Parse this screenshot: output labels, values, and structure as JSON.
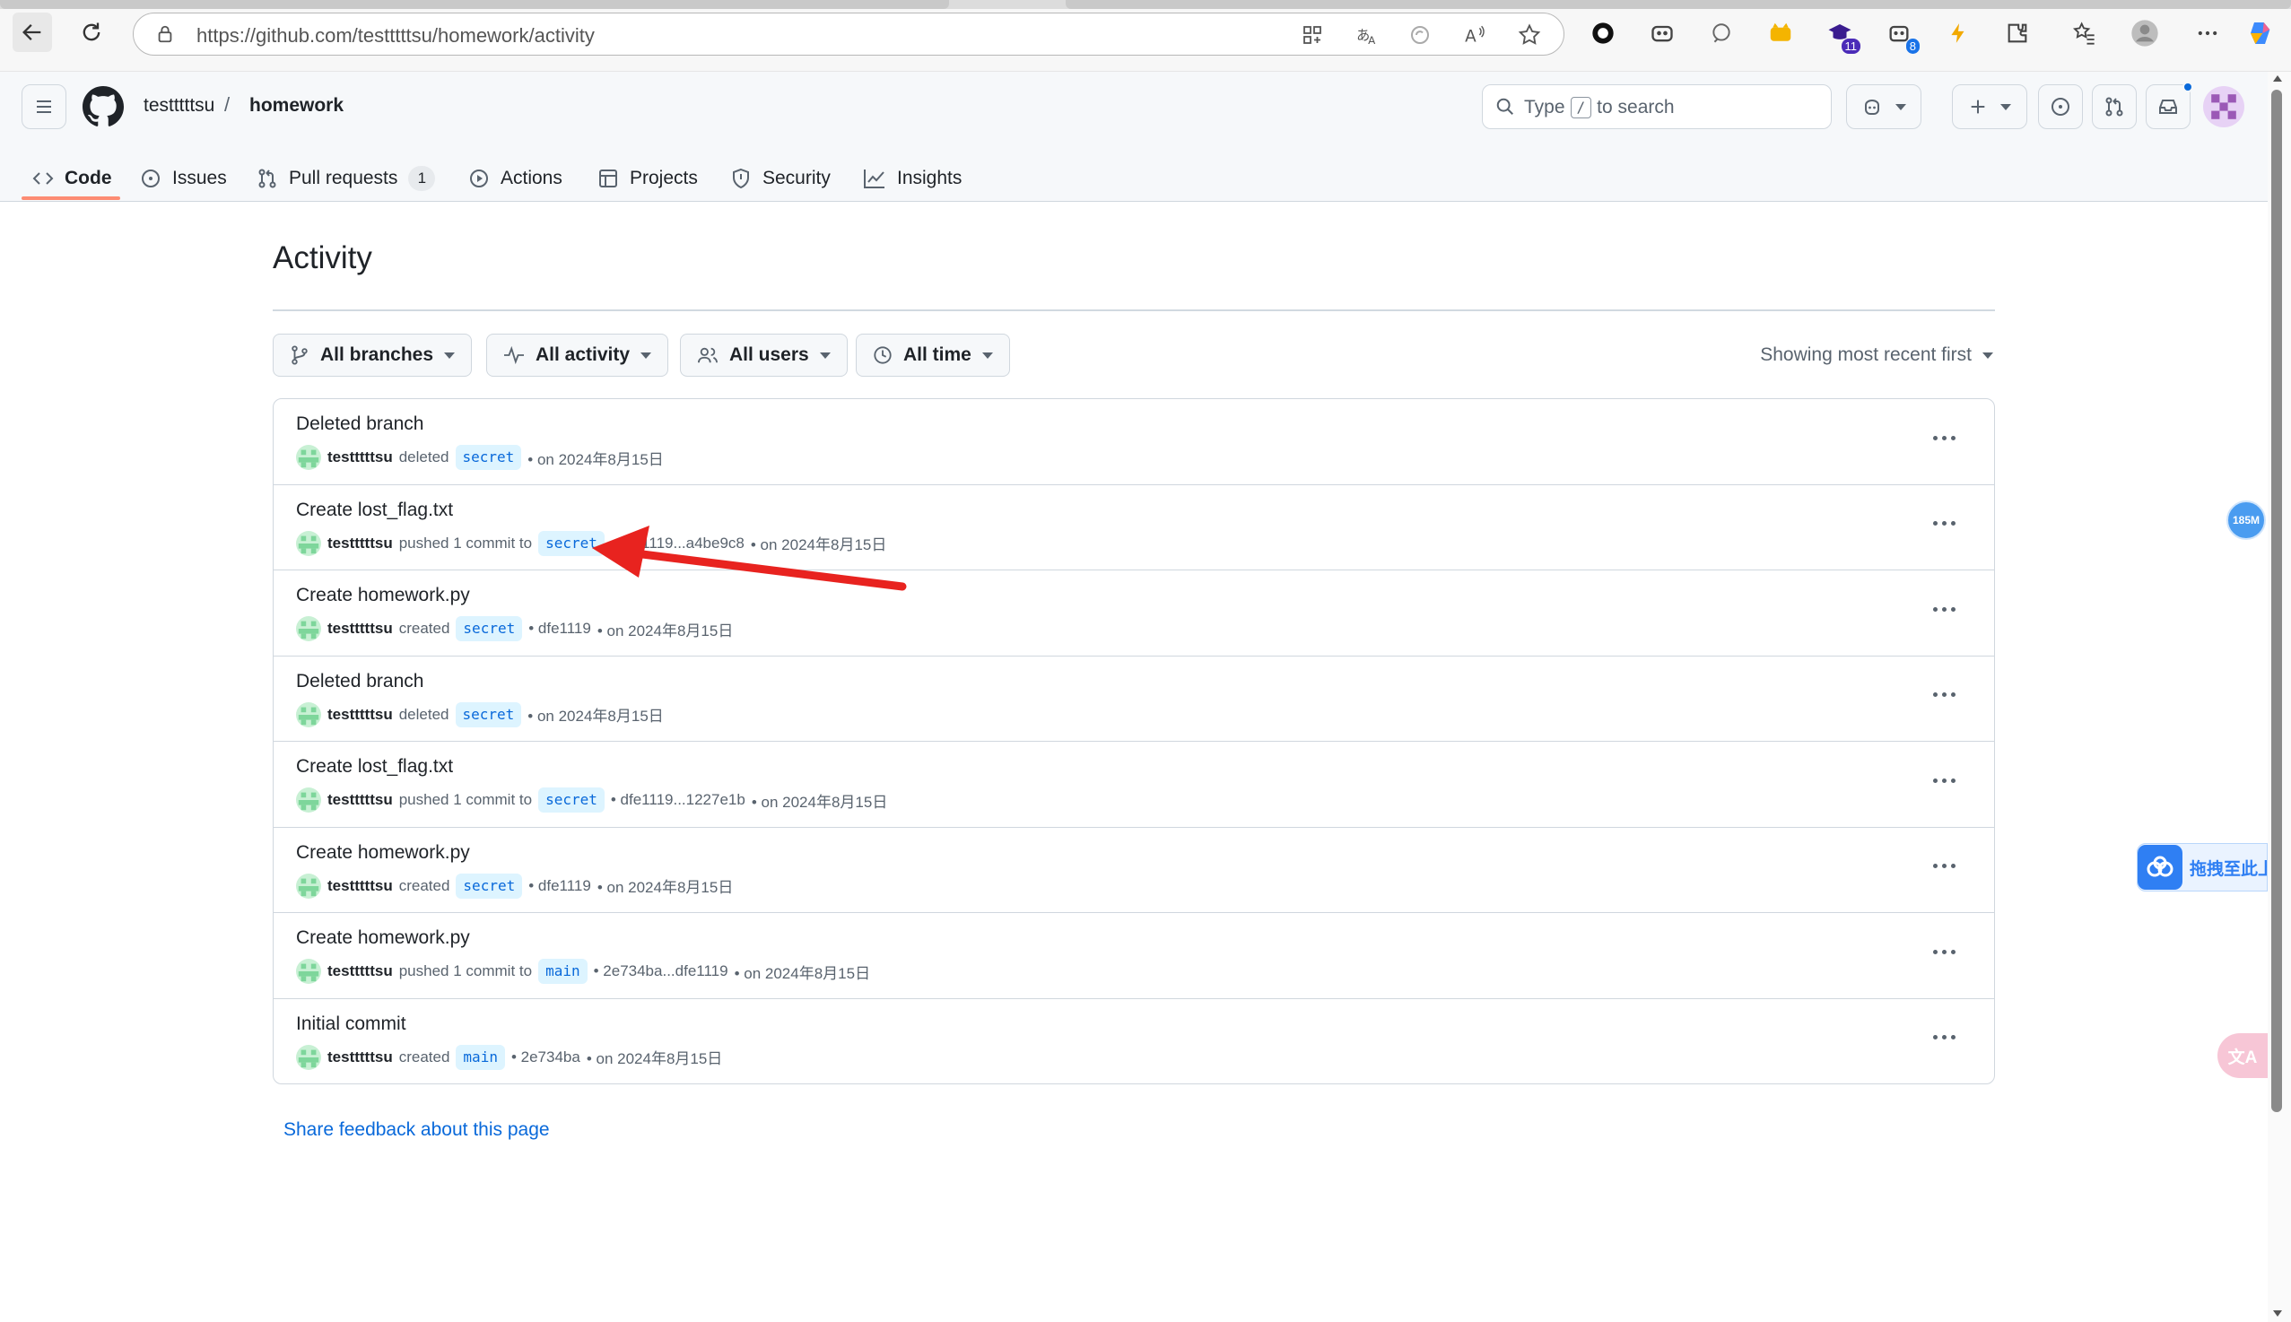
{
  "browser": {
    "url": "https://github.com/testttttsu/homework/activity",
    "extension_badges": {
      "ext_6": "11",
      "ext_7": "8"
    }
  },
  "header": {
    "owner": "testttttsu",
    "separator": "/",
    "repo": "homework",
    "search": {
      "pre": "Type",
      "key": "/",
      "post": "to search"
    }
  },
  "tabs": [
    {
      "label": "Code",
      "icon": "code-icon",
      "selected": true
    },
    {
      "label": "Issues",
      "icon": "issue-icon"
    },
    {
      "label": "Pull requests",
      "icon": "pull-request-icon",
      "count": "1"
    },
    {
      "label": "Actions",
      "icon": "play-icon"
    },
    {
      "label": "Projects",
      "icon": "table-icon"
    },
    {
      "label": "Security",
      "icon": "shield-icon"
    },
    {
      "label": "Insights",
      "icon": "graph-icon"
    }
  ],
  "page": {
    "title": "Activity",
    "filters": {
      "branches": "All branches",
      "activity": "All activity",
      "users": "All users",
      "time": "All time"
    },
    "sort": "Showing most recent first",
    "feedback": "Share feedback about this page"
  },
  "activities": [
    {
      "title": "Deleted branch",
      "user": "testttttsu",
      "verb": "deleted",
      "branch": "secret",
      "sha": "",
      "date": "• on 2024年8月15日"
    },
    {
      "title": "Create lost_flag.txt",
      "user": "testttttsu",
      "verb": "pushed 1 commit to",
      "branch": "secret",
      "sha": "• dfe1119...a4be9c8",
      "date": "• on 2024年8月15日"
    },
    {
      "title": "Create homework.py",
      "user": "testttttsu",
      "verb": "created",
      "branch": "secret",
      "sha": "• dfe1119",
      "date": "• on 2024年8月15日"
    },
    {
      "title": "Deleted branch",
      "user": "testttttsu",
      "verb": "deleted",
      "branch": "secret",
      "sha": "",
      "date": "• on 2024年8月15日"
    },
    {
      "title": "Create lost_flag.txt",
      "user": "testttttsu",
      "verb": "pushed 1 commit to",
      "branch": "secret",
      "sha": "• dfe1119...1227e1b",
      "date": "• on 2024年8月15日"
    },
    {
      "title": "Create homework.py",
      "user": "testttttsu",
      "verb": "created",
      "branch": "secret",
      "sha": "• dfe1119",
      "date": "• on 2024年8月15日"
    },
    {
      "title": "Create homework.py",
      "user": "testttttsu",
      "verb": "pushed 1 commit to",
      "branch": "main",
      "sha": "• 2e734ba...dfe1119",
      "date": "• on 2024年8月15日"
    },
    {
      "title": "Initial commit",
      "user": "testttttsu",
      "verb": "created",
      "branch": "main",
      "sha": "• 2e734ba",
      "date": "• on 2024年8月15日"
    }
  ],
  "overlays": {
    "memory_badge": "185M",
    "upload_widget": "拖拽至此上传",
    "translate_badge": "文A"
  },
  "colors": {
    "accent": "#fd8c73",
    "link": "#0969da",
    "arrow": "#e8231f"
  }
}
